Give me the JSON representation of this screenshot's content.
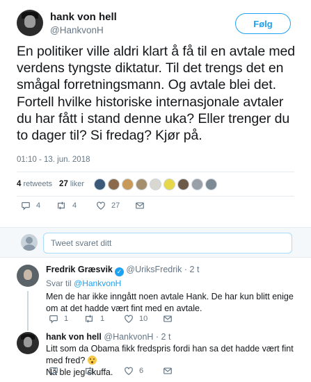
{
  "tweet": {
    "author_name": "hank von hell",
    "author_handle": "@HankvonH",
    "follow_label": "Følg",
    "text": "En politiker ville aldri klart å få til en avtale med verdens tyngste diktatur. Til det trengs det en smågal forretningsmann. Og avtale blei det. Fortell hvilke historiske internasjonale avtaler du har fått i stand denne uka? Eller trenger du to dager til? Si fredag? Kjør på.",
    "timestamp": "01:10 - 13. jun. 2018",
    "retweets_count": "4",
    "retweets_label": "retweets",
    "likes_count": "27",
    "likes_label": "liker",
    "actions": {
      "replies": "4",
      "retweets": "4",
      "likes": "27"
    }
  },
  "reply_box": {
    "placeholder": "Tweet svaret ditt"
  },
  "replies": [
    {
      "name": "Fredrik Græsvik",
      "verified": true,
      "handle": "@UriksFredrik",
      "time": "· 2 t",
      "reply_to_prefix": "Svar til",
      "reply_to_handle": "@HankvonH",
      "text": "Men de har ikke inngått noen avtale Hank. De har kun blitt enige om at det hadde vært fint med en avtale.",
      "actions": {
        "replies": "1",
        "retweets": "1",
        "likes": "10"
      }
    },
    {
      "name": "hank von hell",
      "handle": "@HankvonH",
      "time": "· 2 t",
      "text_line1": "Litt som da Obama fikk fredspris fordi han sa det hadde vært fint med fred?",
      "text_line2": "Nå ble jeg skuffa.",
      "actions": {
        "replies": "",
        "retweets": "",
        "likes": "6"
      }
    }
  ],
  "colors": {
    "accent": "#1da1f2",
    "muted": "#657786",
    "text": "#14171a",
    "divider": "#e6ecf0"
  },
  "icons": [
    "reply-icon",
    "retweet-icon",
    "heart-icon",
    "message-icon",
    "verified-icon"
  ]
}
